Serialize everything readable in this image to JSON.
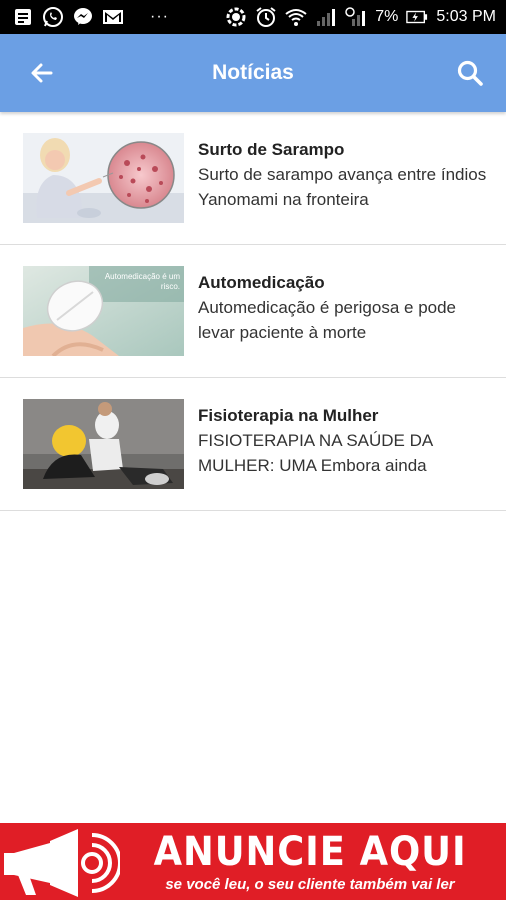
{
  "status_bar": {
    "left_icons": [
      "notes-icon",
      "whatsapp-icon",
      "messenger-icon",
      "gmail-icon"
    ],
    "more_label": "···",
    "right_icons": [
      "sync-icon",
      "alarm-icon",
      "wifi-icon",
      "signal-icon",
      "signal-icon"
    ],
    "battery": "7%",
    "time": "5:03 PM"
  },
  "app_bar": {
    "title": "Notícias",
    "back_icon": "arrow-back-icon",
    "search_icon": "search-icon",
    "color": "#6b9fe4"
  },
  "news": [
    {
      "title": "Surto de Sarampo",
      "summary": "Surto de sarampo avança entre índios Yanomami na fronteira",
      "thumb_icon": "measles-illustration-image"
    },
    {
      "title": "Automedicação",
      "summary": "Automedicação é perigosa e pode levar paciente à morte",
      "thumb_icon": "pill-in-hand-image",
      "thumb_caption": "Automedicação é um risco."
    },
    {
      "title": "Fisioterapia na Mulher",
      "summary": "FISIOTERAPIA NA SAÚDE DA MULHER: UMA Embora ainda",
      "thumb_icon": "physiotherapy-photo-image"
    }
  ],
  "ad": {
    "title": "ANUNCIE AQUI",
    "subtitle": "se você leu, o seu cliente também vai ler",
    "color": "#e01e26",
    "icon": "megaphone-icon"
  }
}
